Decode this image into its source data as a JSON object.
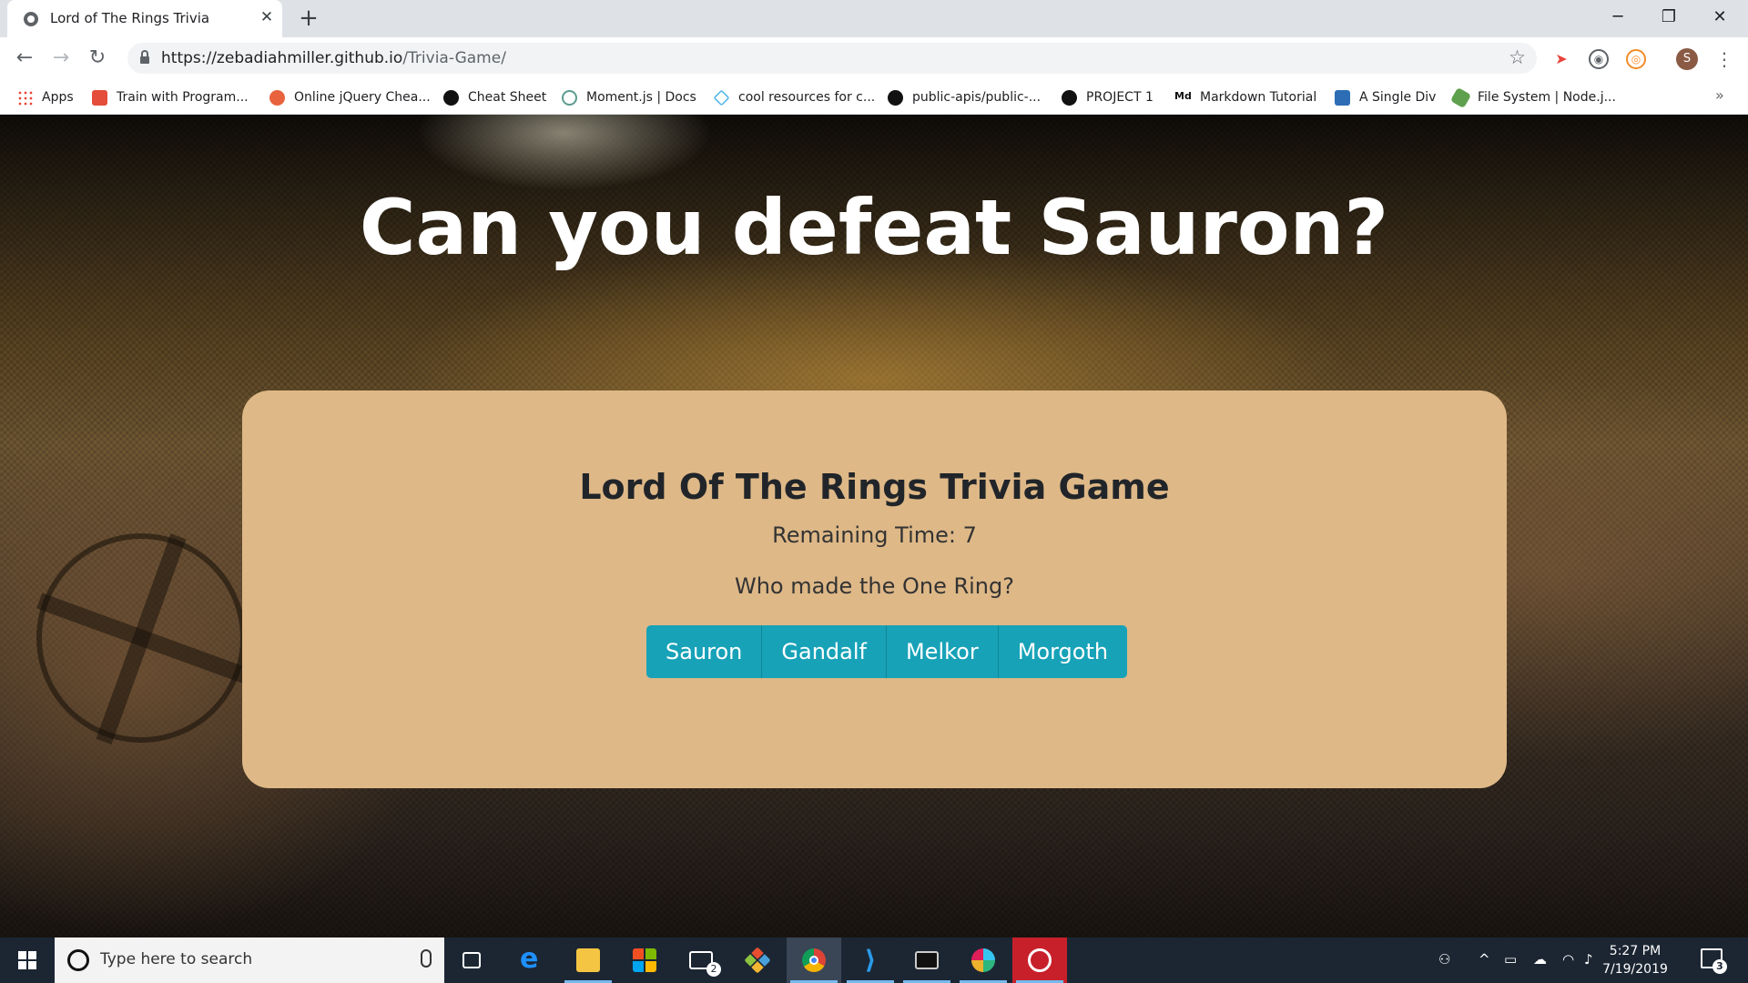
{
  "browser": {
    "tab_title": "Lord of The Rings Trivia",
    "url_host": "https://zebadiahmiller.github.io",
    "url_path": "/Trivia-Game/",
    "profile_initial": "S",
    "bookmarks": [
      {
        "label": "Apps",
        "icon": "apps-grid-icon",
        "color": "#ea4335"
      },
      {
        "label": "Train with Program...",
        "icon": "program-icon",
        "color": "#e44d3a"
      },
      {
        "label": "Online jQuery Chea...",
        "icon": "jquery-icon",
        "color": "#e8623d"
      },
      {
        "label": "Cheat Sheet",
        "icon": "cheat-sheet-icon",
        "color": "#111111"
      },
      {
        "label": "Moment.js | Docs",
        "icon": "clock-icon",
        "color": "#5a9c8f"
      },
      {
        "label": "cool resources for c...",
        "icon": "diamond-icon",
        "color": "#4fb3e8"
      },
      {
        "label": "public-apis/public-...",
        "icon": "github-icon",
        "color": "#111111"
      },
      {
        "label": "PROJECT 1",
        "icon": "github-icon",
        "color": "#111111"
      },
      {
        "label": "Markdown Tutorial",
        "icon": "markdown-icon",
        "color": "#111111"
      },
      {
        "label": "A Single Div",
        "icon": "code-icon",
        "color": "#2d6db5"
      },
      {
        "label": "File System | Node.j...",
        "icon": "nodejs-icon",
        "color": "#5fa04e"
      }
    ]
  },
  "page": {
    "hero_title": "Can you defeat Sauron?",
    "game_title": "Lord Of The Rings Trivia Game",
    "remaining_time": "Remaining Time: 7",
    "question": "Who made the One Ring?",
    "answers": [
      "Sauron",
      "Gandalf",
      "Melkor",
      "Morgoth"
    ]
  },
  "taskbar": {
    "search_placeholder": "Type here to search",
    "time": "5:27 PM",
    "date": "7/19/2019",
    "mail_badge": "2",
    "notification_count": "3"
  }
}
